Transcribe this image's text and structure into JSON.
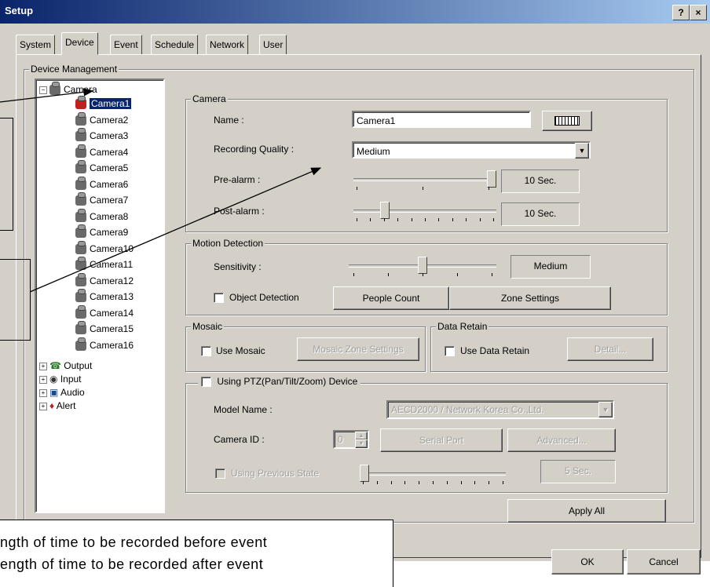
{
  "window": {
    "title": "Setup",
    "help_btn": "?",
    "close_btn": "×"
  },
  "tabs": [
    "System",
    "Device",
    "Event",
    "Schedule",
    "Network",
    "User"
  ],
  "device_management": {
    "label": "Device Management",
    "tree": {
      "root": "Camera",
      "selected": "Camera1",
      "cameras": [
        "Camera1",
        "Camera2",
        "Camera3",
        "Camera4",
        "Camera5",
        "Camera6",
        "Camera7",
        "Camera8",
        "Camera9",
        "Camera10",
        "Camera11",
        "Camera12",
        "Camera13",
        "Camera14",
        "Camera15",
        "Camera16"
      ],
      "others": [
        "Output",
        "Input",
        "Audio",
        "Alert"
      ]
    }
  },
  "camera_group": {
    "label": "Camera",
    "name_label": "Name :",
    "name_value": "Camera1",
    "keyboard_icon": "keyboard-icon",
    "quality_label": "Recording Quality :",
    "quality_value": "Medium",
    "prealarm_label": "Pre-alarm :",
    "prealarm_value": "10 Sec.",
    "prealarm_level": 1.0,
    "postalarm_label": "Post-alarm :",
    "postalarm_value": "10 Sec.",
    "postalarm_level": 0.2
  },
  "motion_group": {
    "label": "Motion Detection",
    "sensitivity_label": "Sensitivity :",
    "sensitivity_value": "Medium",
    "sensitivity_level": 0.5,
    "object_detection_label": "Object Detection",
    "people_count_btn": "People Count",
    "zone_settings_btn": "Zone Settings"
  },
  "mosaic_group": {
    "label": "Mosaic",
    "use_mosaic_label": "Use Mosaic",
    "mosaic_zone_btn": "Mosaic Zone Settings"
  },
  "data_retain_group": {
    "label": "Data Retain",
    "use_label": "Use Data Retain",
    "detail_btn": "Detail..."
  },
  "ptz_group": {
    "label": "Using PTZ(Pan/Tilt/Zoom) Device",
    "model_label": "Model Name :",
    "model_value": "AECD2000 / Network Korea Co.,Ltd.",
    "camera_id_label": "Camera ID :",
    "camera_id_value": "0",
    "serial_port_btn": "Serial Port",
    "advanced_btn": "Advanced...",
    "prev_state_label": "Using Previous State",
    "prev_state_value": "5 Sec.",
    "prev_state_level": 0.0
  },
  "apply_all_btn": "Apply All",
  "ok_btn": "OK",
  "cancel_btn": "Cancel",
  "notes": {
    "line1": "ngth of time to be recorded before event",
    "line2": "ength of time to be recorded after event"
  }
}
